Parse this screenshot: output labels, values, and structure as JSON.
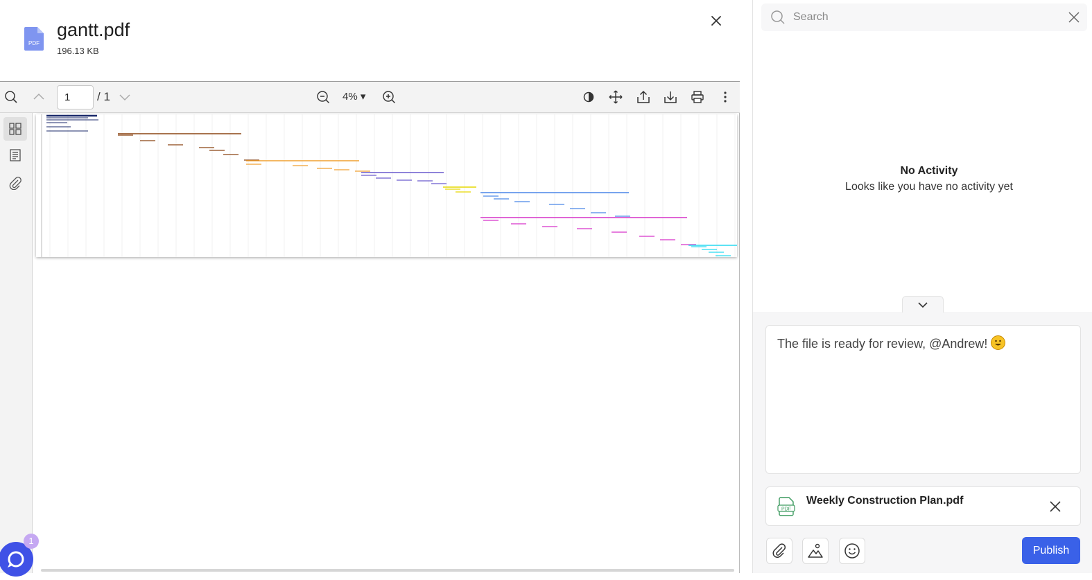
{
  "file": {
    "name": "gantt.pdf",
    "size": "196.13 KB",
    "type_badge": "PDF"
  },
  "toolbar": {
    "page_current": "1",
    "page_total": "/ 1",
    "zoom": "4%",
    "zoom_caret": "▾"
  },
  "side_tools": [
    "thumbnails-icon",
    "outline-icon",
    "attachments-icon"
  ],
  "gantt_preview": {
    "colors": [
      "#1b2a6b",
      "#8b4513",
      "#f0a030",
      "#6a5acd",
      "#e6d800",
      "#4a86e8",
      "#d633c9",
      "#26d9f0"
    ]
  },
  "chat_widget": {
    "badge": "1"
  },
  "panel": {
    "search_placeholder": "Search",
    "empty_title": "No Activity",
    "empty_subtitle": "Looks like you have no activity yet",
    "comment_text": "The file is ready for review, @Andrew! ",
    "attachment": {
      "name": "Weekly Construction Plan.pdf",
      "badge": "PDF"
    },
    "publish_label": "Publish"
  },
  "colors": {
    "accent": "#3a61e8",
    "pdf_icon": "#7f95f0",
    "attach_icon": "#3c9a5f"
  }
}
